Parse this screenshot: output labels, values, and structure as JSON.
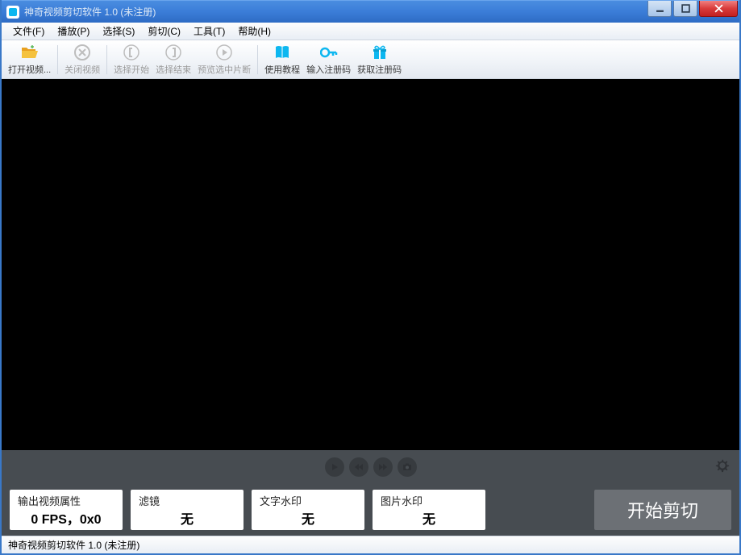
{
  "titlebar": {
    "title": "神奇视频剪切软件 1.0 (未注册)"
  },
  "menu": {
    "file": "文件(F)",
    "play": "播放(P)",
    "select": "选择(S)",
    "cut": "剪切(C)",
    "tools": "工具(T)",
    "help": "帮助(H)"
  },
  "toolbar": {
    "open_video": "打开视频...",
    "close_video": "关闭视频",
    "select_start": "选择开始",
    "select_end": "选择结束",
    "preview_selection": "预览选中片断",
    "tutorial": "使用教程",
    "enter_code": "输入注册码",
    "get_code": "获取注册码"
  },
  "panels": {
    "output_props_title": "输出视频属性",
    "output_props_value": "0 FPS，0x0",
    "filter_title": "滤镜",
    "filter_value": "无",
    "text_wm_title": "文字水印",
    "text_wm_value": "无",
    "image_wm_title": "图片水印",
    "image_wm_value": "无"
  },
  "actions": {
    "start_cut": "开始剪切"
  },
  "statusbar": {
    "text": "神奇视频剪切软件 1.0 (未注册)"
  }
}
